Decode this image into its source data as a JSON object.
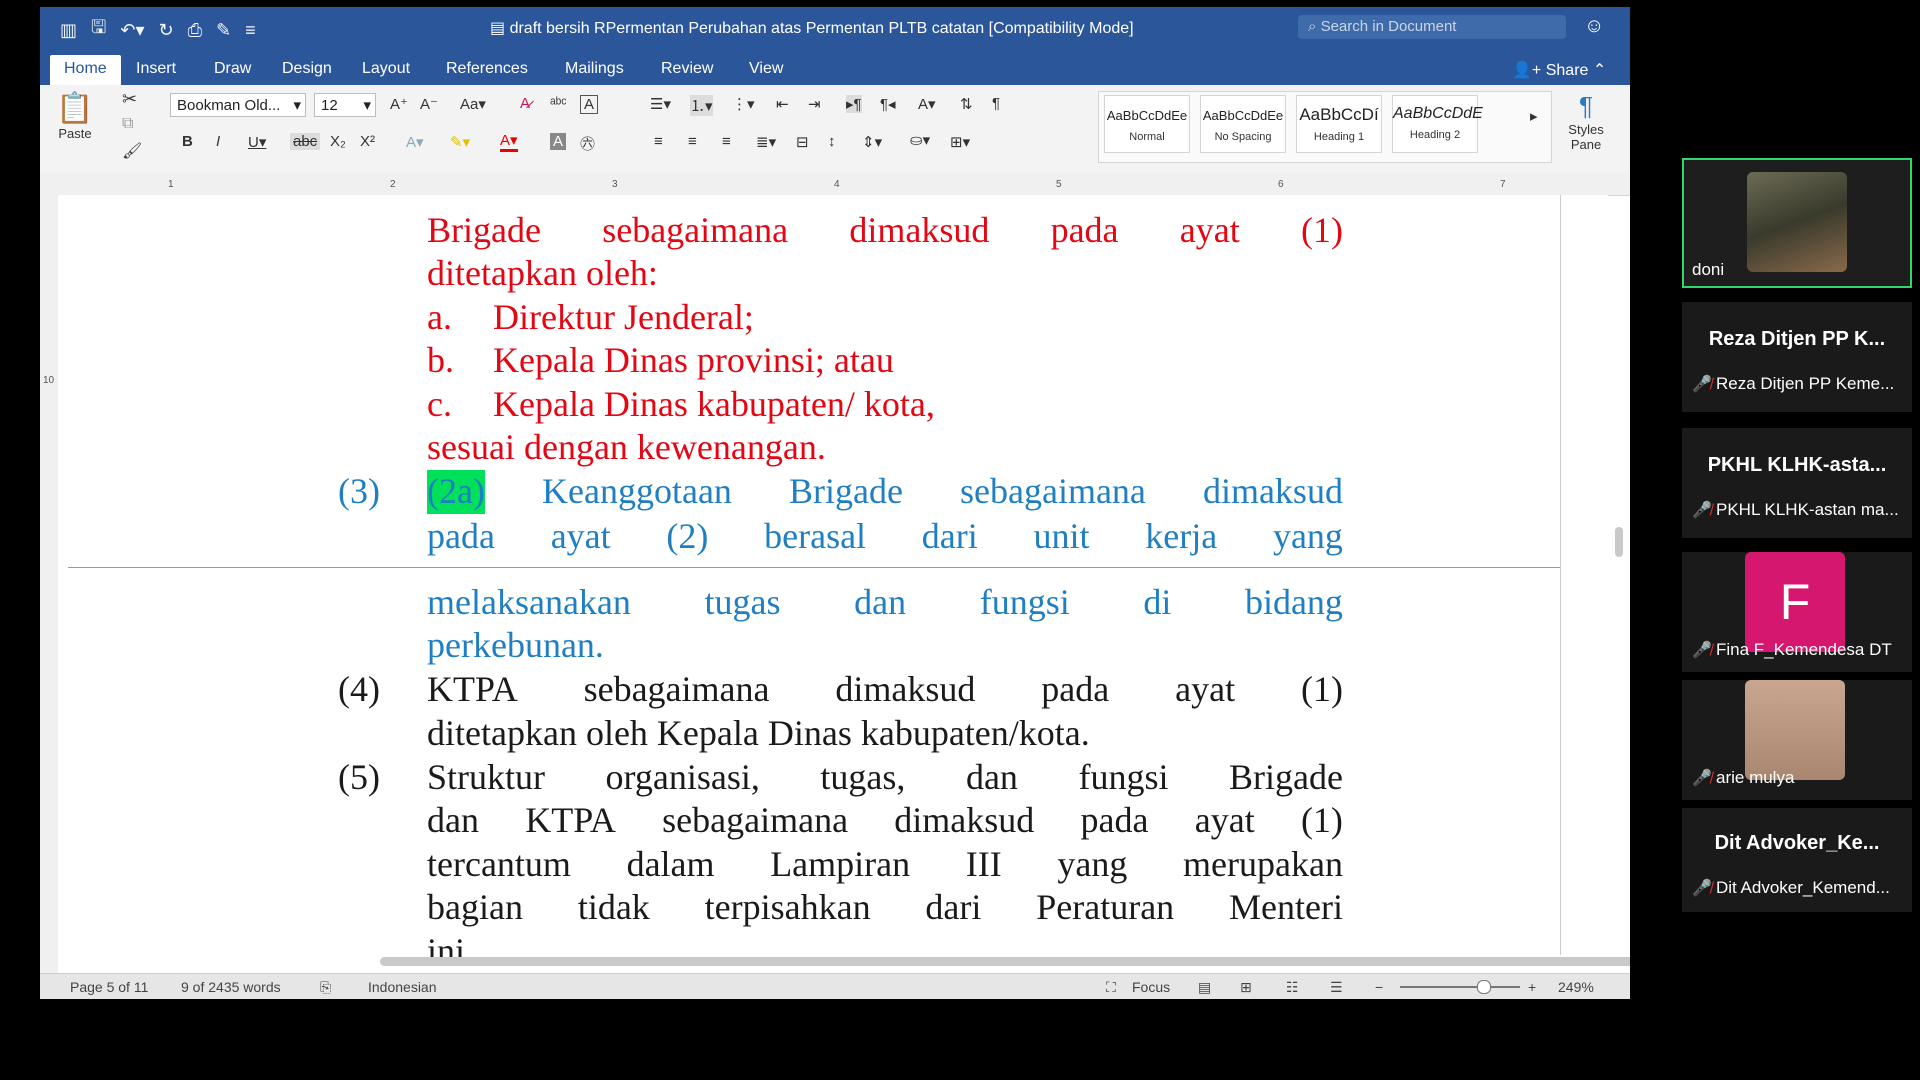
{
  "window": {
    "title": "draft bersih RPermentan Perubahan atas Permentan PLTB catatan [Compatibility Mode]",
    "search_placeholder": "Search in Document",
    "share_label": "Share"
  },
  "menu_tabs": [
    "Home",
    "Insert",
    "Draw",
    "Design",
    "Layout",
    "References",
    "Mailings",
    "Review",
    "View"
  ],
  "ribbon": {
    "paste_label": "Paste",
    "font_name": "Bookman Old...",
    "font_size": "12",
    "styles": [
      {
        "preview": "AaBbCcDdEe",
        "name": "Normal"
      },
      {
        "preview": "AaBbCcDdEe",
        "name": "No Spacing"
      },
      {
        "preview": "AaBbCcDí",
        "name": "Heading 1"
      },
      {
        "preview": "AaBbCcDdE",
        "name": "Heading 2"
      }
    ],
    "styles_pane_label": "Styles Pane"
  },
  "ruler_marks": [
    "1",
    "2",
    "3",
    "4",
    "5",
    "6",
    "7"
  ],
  "vruler_mark": "10",
  "document": {
    "red_lines": {
      "l1": [
        "Brigade",
        "sebagaimana",
        "dimaksud",
        "pada",
        "ayat",
        "(1)"
      ],
      "l2": "ditetapkan oleh:",
      "a_num": "a.",
      "a_text": "Direktur Jenderal;",
      "b_num": "b.",
      "b_text": "Kepala Dinas provinsi; atau",
      "c_num": "c.",
      "c_text": "Kepala Dinas kabupaten/ kota,",
      "l6": "sesuai dengan kewenangan."
    },
    "para3": {
      "num": "(3)",
      "highlight": "(2a)",
      "line1_rest": [
        "Keanggotaan",
        "Brigade",
        "sebagaimana",
        "dimaksud"
      ],
      "line2": [
        "pada",
        "ayat",
        "(2)",
        "berasal",
        "dari",
        "unit",
        "kerja",
        "yang"
      ],
      "line3": [
        "melaksanakan",
        "tugas",
        "dan",
        "fungsi",
        "di",
        "bidang"
      ],
      "line4": "perkebunan."
    },
    "para4": {
      "num": "(4)",
      "line1": [
        "KTPA",
        "sebagaimana",
        "dimaksud",
        "pada",
        "ayat",
        "(1)"
      ],
      "line2": "ditetapkan oleh Kepala Dinas kabupaten/kota."
    },
    "para5": {
      "num": "(5)",
      "line1": [
        "Struktur",
        "organisasi,",
        "tugas,",
        "dan",
        "fungsi",
        "Brigade"
      ],
      "line2": [
        "dan",
        "KTPA",
        "sebagaimana",
        "dimaksud",
        "pada",
        "ayat",
        "(1)"
      ],
      "line3": [
        "tercantum",
        "dalam",
        "Lampiran",
        "III",
        "yang",
        "merupakan"
      ],
      "line4": [
        "bagian",
        "tidak",
        "terpisahkan",
        "dari",
        "Peraturan",
        "Menteri"
      ],
      "line5": "ini."
    }
  },
  "status": {
    "page": "Page 5 of 11",
    "words": "9 of 2435 words",
    "language": "Indonesian",
    "focus": "Focus",
    "zoom": "249%"
  },
  "participants": [
    {
      "name": "doni",
      "type": "video",
      "active": true
    },
    {
      "heading": "Reza Ditjen PP K...",
      "label": "Reza Ditjen PP Keme...",
      "muted": true
    },
    {
      "heading": "PKHL KLHK-asta...",
      "label": "PKHL KLHK-astan ma...",
      "muted": true
    },
    {
      "initial": "F",
      "label": "Fina F_Kemendesa DT",
      "muted": true,
      "color": "#d6176f"
    },
    {
      "label": "arie mulya",
      "muted": true,
      "type": "photo"
    },
    {
      "heading": "Dit Advoker_Ke...",
      "label": "Dit Advoker_Kemend...",
      "muted": true
    }
  ]
}
